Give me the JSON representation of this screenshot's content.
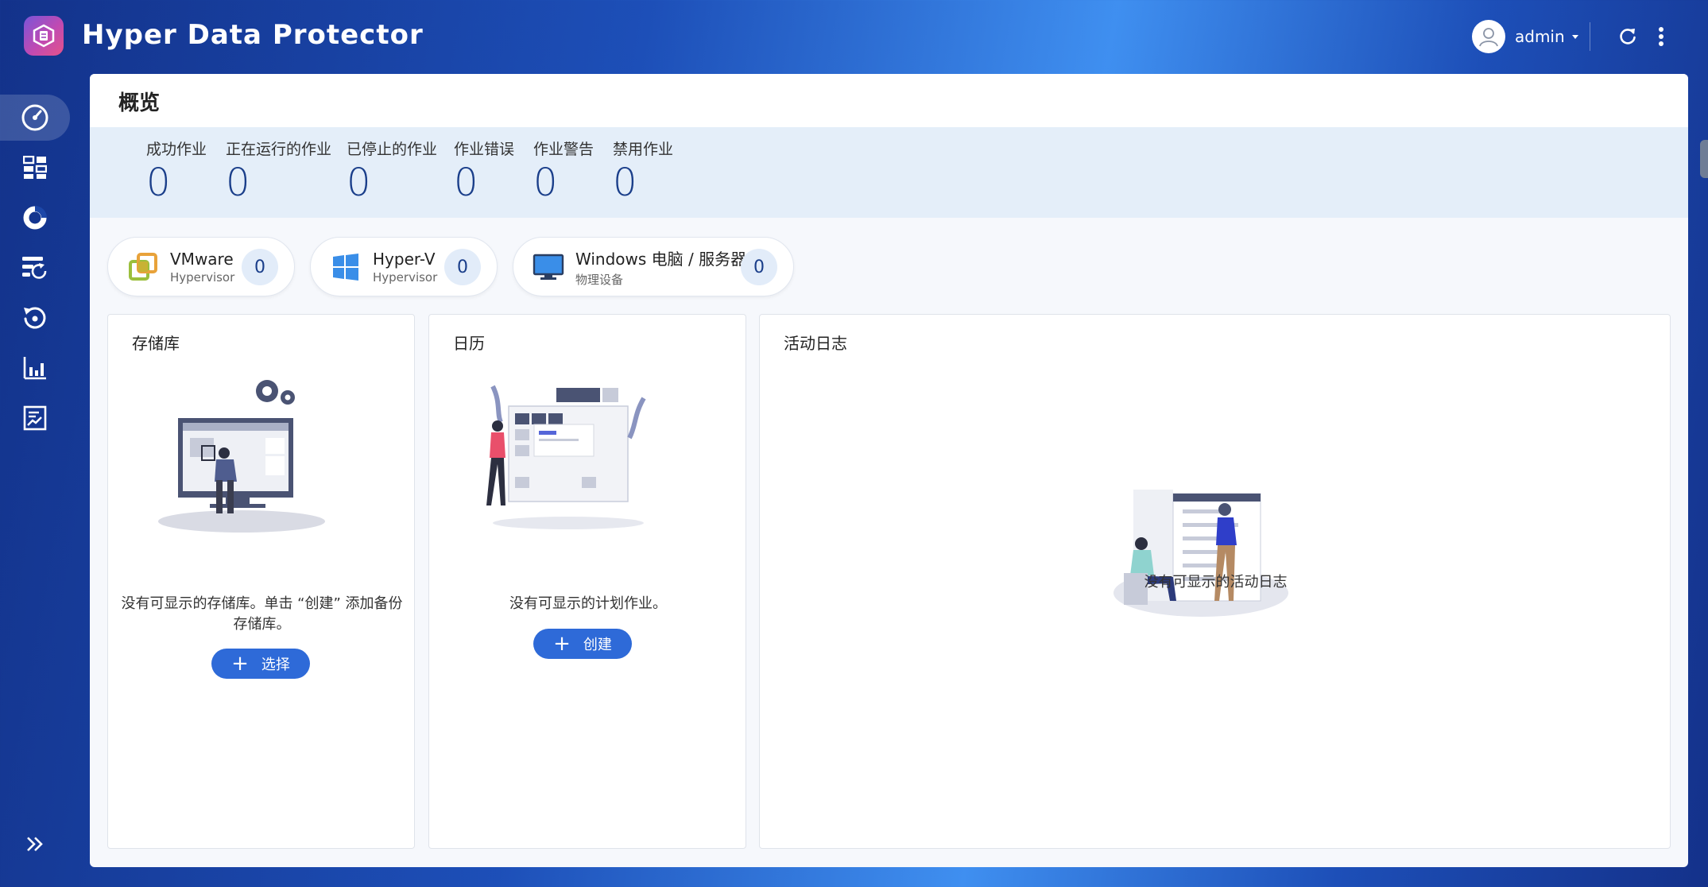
{
  "app": {
    "title": "Hyper Data Protector",
    "user": "admin"
  },
  "sidebar": {
    "items": [
      {
        "icon": "dashboard-gauge-icon",
        "active": true
      },
      {
        "icon": "grid-apps-icon"
      },
      {
        "icon": "storage-pie-icon"
      },
      {
        "icon": "backup-jobs-icon"
      },
      {
        "icon": "restore-icon"
      },
      {
        "icon": "report-chart-icon"
      },
      {
        "icon": "log-document-icon"
      }
    ]
  },
  "overview": {
    "title": "概览",
    "stats": [
      {
        "label": "成功作业",
        "value": "0"
      },
      {
        "label": "正在运行的作业",
        "value": "0"
      },
      {
        "label": "已停止的作业",
        "value": "0"
      },
      {
        "label": "作业错误",
        "value": "0"
      },
      {
        "label": "作业警告",
        "value": "0"
      },
      {
        "label": "禁用作业",
        "value": "0"
      }
    ]
  },
  "platforms": [
    {
      "title": "VMware",
      "subtitle": "Hypervisor",
      "count": "0",
      "icon": "vmware-icon"
    },
    {
      "title": "Hyper-V",
      "subtitle": "Hypervisor",
      "count": "0",
      "icon": "windows-icon"
    },
    {
      "title": "Windows 电脑 / 服务器",
      "subtitle": "物理设备",
      "count": "0",
      "icon": "monitor-icon"
    }
  ],
  "cards": {
    "repository": {
      "title": "存储库",
      "message_line1": "没有可显示的存储库。单击 “创建” 添加备份",
      "message_line2": "存储库。",
      "button": "选择"
    },
    "calendar": {
      "title": "日历",
      "message": "没有可显示的计划作业。",
      "button": "创建"
    },
    "activity_log": {
      "title": "活动日志",
      "message": "没有可显示的活动日志"
    }
  },
  "colors": {
    "accent": "#2e6ad8",
    "stat_value": "#1a3e8a",
    "stats_bg": "#e4eef9"
  }
}
